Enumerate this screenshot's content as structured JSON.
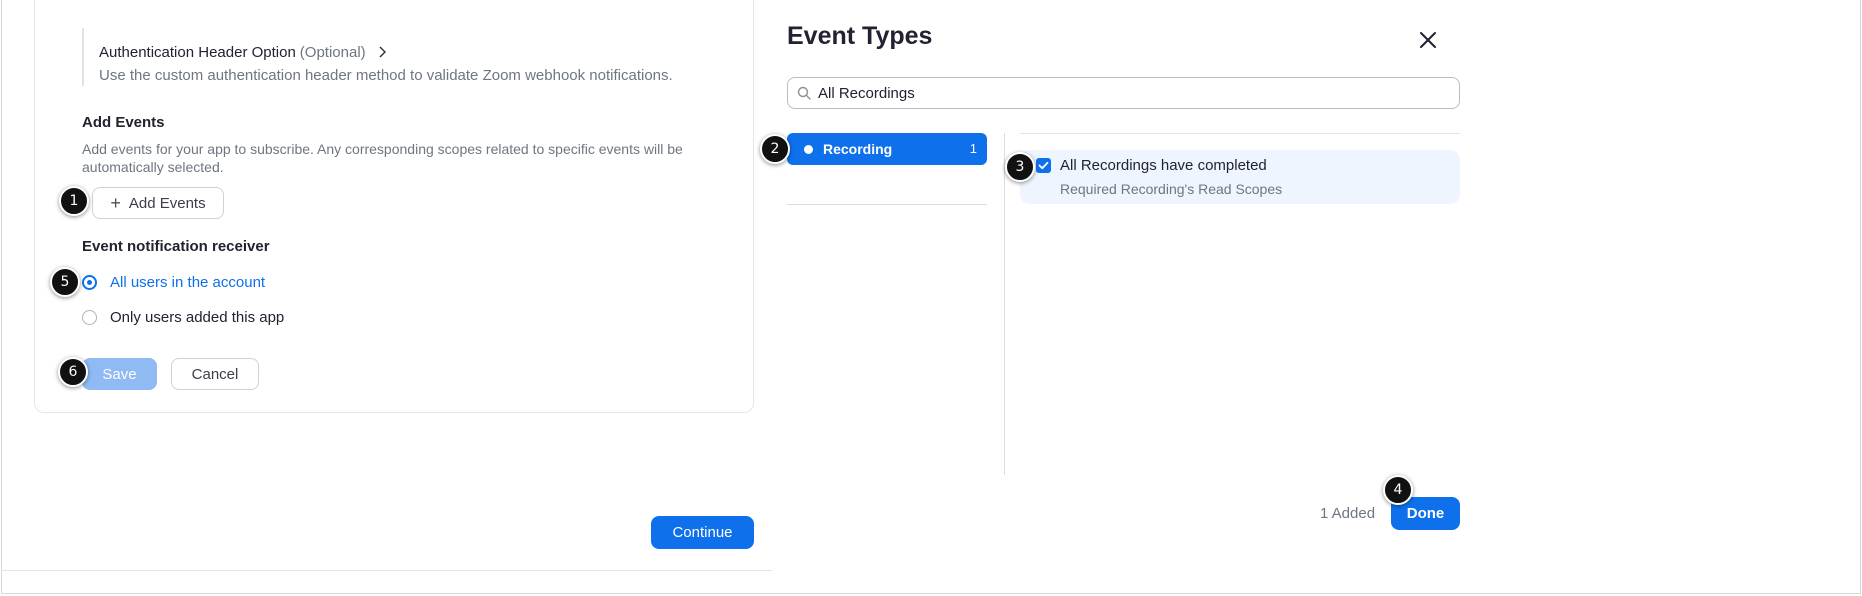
{
  "left": {
    "auth": {
      "title": "Authentication Header Option",
      "optional": "(Optional)",
      "chevron_icon": "chevron-right-icon",
      "description": "Use the custom authentication header method to validate Zoom webhook notifications."
    },
    "add_events": {
      "heading": "Add Events",
      "description": "Add events for your app to subscribe. Any corresponding scopes related to specific events will be automatically selected.",
      "button_label": "Add Events"
    },
    "receiver": {
      "heading": "Event notification receiver",
      "options": [
        {
          "label": "All users in the account",
          "selected": true
        },
        {
          "label": "Only users added this app",
          "selected": false
        }
      ]
    },
    "save_label": "Save",
    "cancel_label": "Cancel",
    "continue_label": "Continue"
  },
  "panel": {
    "title": "Event Types",
    "search_value": "All Recordings",
    "categories": [
      {
        "label": "Recording",
        "count": "1",
        "selected": true
      }
    ],
    "events": [
      {
        "title": "All Recordings have completed",
        "subtitle": "Required Recording's Read Scopes",
        "checked": true
      }
    ],
    "added_count": "1 Added",
    "done_label": "Done"
  },
  "markers": [
    "1",
    "2",
    "3",
    "4",
    "5",
    "6"
  ],
  "colors": {
    "accent": "#0e71eb",
    "accent_disabled": "#8fbaf3",
    "selected_row_bg": "#eef5fe",
    "muted_text": "#6e7680"
  }
}
